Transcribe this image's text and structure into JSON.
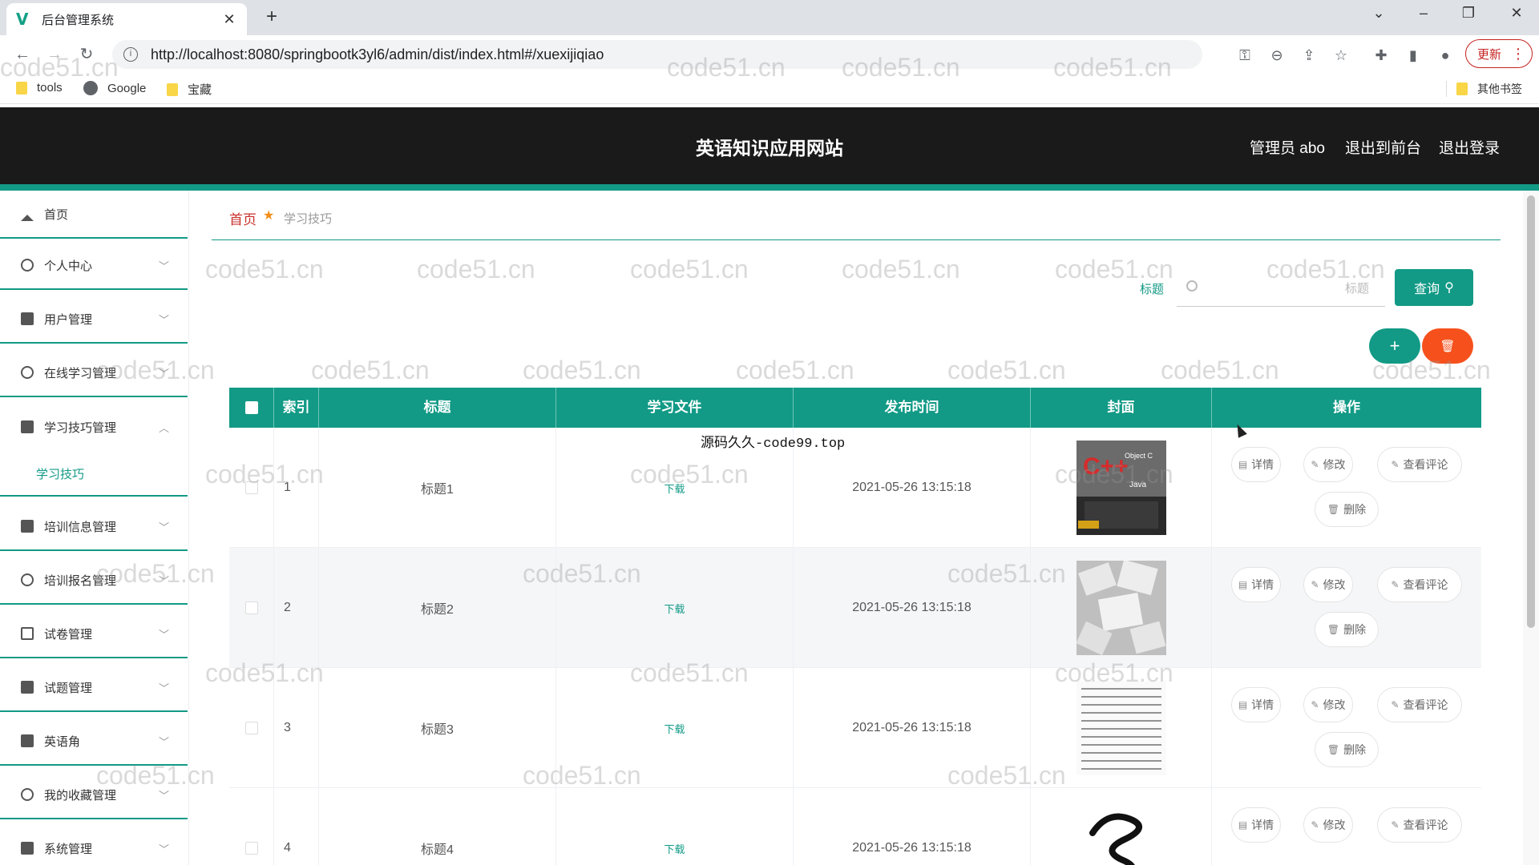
{
  "browser": {
    "tab_title": "后台管理系统",
    "tab_close": "✕",
    "new_tab": "+",
    "url": "http://localhost:8080/springbootk3yl6/admin/dist/index.html#/xuexijiqiao",
    "update_label": "更新",
    "bookmarks": [
      "tools",
      "Google",
      "宝藏"
    ],
    "other_bookmarks": "其他书签"
  },
  "header": {
    "site_title": "英语知识应用网站",
    "admin_label": "管理员 abo",
    "back_front": "退出到前台",
    "logout": "退出登录"
  },
  "sidebar": {
    "items": [
      {
        "label": "首页",
        "icon": "home-icon"
      },
      {
        "label": "个人中心",
        "icon": "user-icon"
      },
      {
        "label": "用户管理",
        "icon": "users-icon"
      },
      {
        "label": "在线学习管理",
        "icon": "study-icon"
      },
      {
        "label": "学习技巧管理",
        "icon": "tips-icon"
      },
      {
        "label": "学习技巧",
        "icon": ""
      },
      {
        "label": "培训信息管理",
        "icon": "training-icon"
      },
      {
        "label": "培训报名管理",
        "icon": "signup-icon"
      },
      {
        "label": "试卷管理",
        "icon": "paper-icon"
      },
      {
        "label": "试题管理",
        "icon": "question-icon"
      },
      {
        "label": "英语角",
        "icon": "corner-icon"
      },
      {
        "label": "我的收藏管理",
        "icon": "favorite-icon"
      },
      {
        "label": "系统管理",
        "icon": "system-icon"
      }
    ]
  },
  "breadcrumb": {
    "home": "首页",
    "current": "学习技巧"
  },
  "search": {
    "label": "标题",
    "placeholder": "标题",
    "query_button": "查询",
    "add_button": "+",
    "delete_button": "🗑"
  },
  "table": {
    "headers": [
      "索引",
      "标题",
      "学习文件",
      "发布时间",
      "封面",
      "操作"
    ],
    "rows": [
      {
        "index": "1",
        "title": "标题1",
        "file": "下载",
        "time": "2021-05-26 13:15:18"
      },
      {
        "index": "2",
        "title": "标题2",
        "file": "下载",
        "time": "2021-05-26 13:15:18"
      },
      {
        "index": "3",
        "title": "标题3",
        "file": "下载",
        "time": "2021-05-26 13:15:18"
      },
      {
        "index": "4",
        "title": "标题4",
        "file": "下载",
        "time": "2021-05-26 13:15:18"
      }
    ],
    "actions": {
      "detail": "详情",
      "edit": "修改",
      "comments": "查看评论",
      "delete": "删除"
    }
  },
  "overlay_text": "源码久久-code99.top",
  "watermark": "code51.cn",
  "colors": {
    "primary": "#129a86",
    "danger": "#f6511d",
    "header_bg": "#1a1a1a"
  }
}
